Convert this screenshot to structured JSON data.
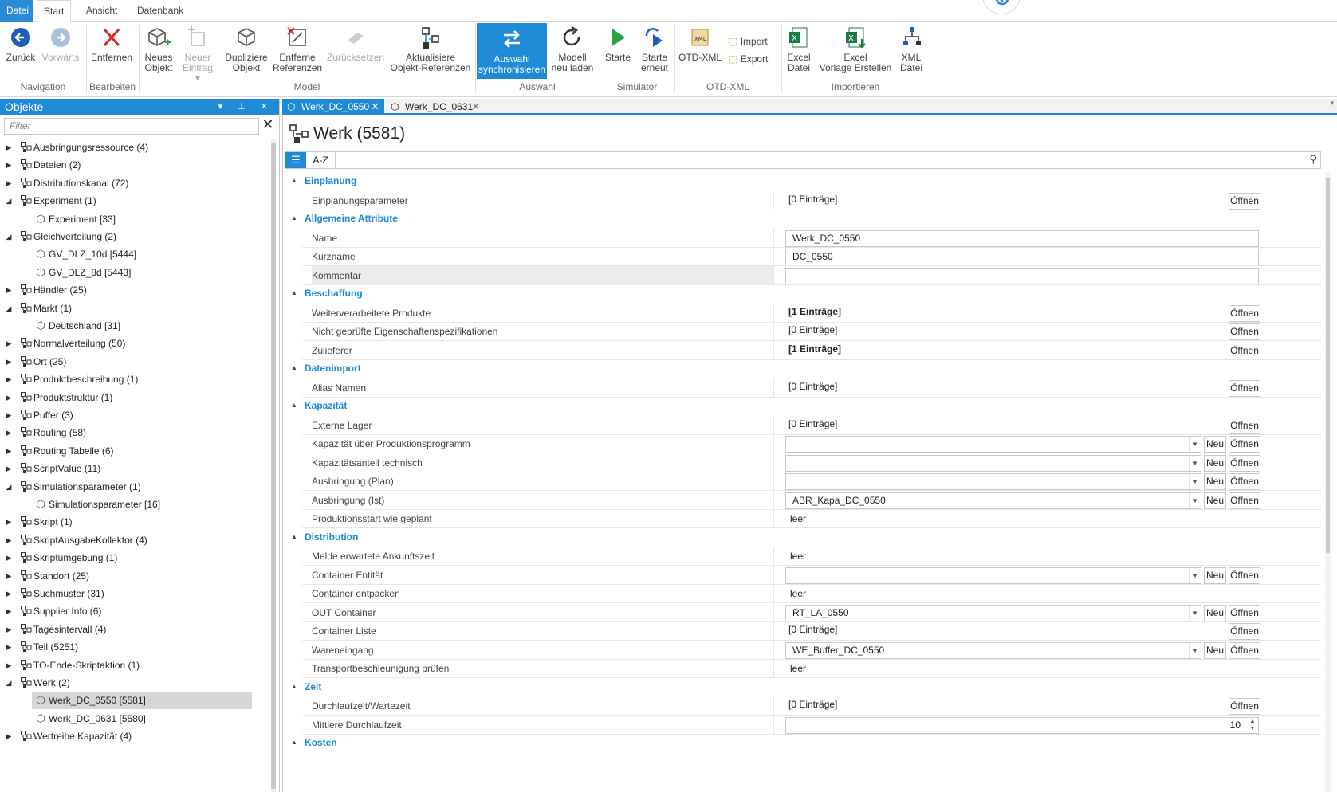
{
  "menu": {
    "file": "Datei",
    "tabs": [
      "Start",
      "Ansicht",
      "Datenbank"
    ]
  },
  "ribbon": {
    "back": "Zurück",
    "forward": "Vorwärts",
    "remove": "Entfernen",
    "new_object_1": "Neues",
    "new_object_2": "Objekt",
    "new_entry_1": "Neuer",
    "new_entry_2": "Eintrag ▾",
    "duplicate_1": "Dupliziere",
    "duplicate_2": "Objekt",
    "remove_refs_1": "Entferne",
    "remove_refs_2": "Referenzen",
    "reset": "Zurücksetzen",
    "update_refs_1": "Aktualisiere",
    "update_refs_2": "Objekt-Referenzen",
    "sync_1": "Auswahl",
    "sync_2": "synchronisieren",
    "reload_1": "Modell",
    "reload_2": "neu laden",
    "start": "Starte",
    "restart_1": "Starte",
    "restart_2": "erneut",
    "otd": "OTD-XML",
    "import": "Import",
    "export": "Export",
    "excel_1": "Excel",
    "excel_2": "Datei",
    "excel_tpl_1": "Excel",
    "excel_tpl_2": "Vorlage Erstellen",
    "xml_1": "XML",
    "xml_2": "Datei",
    "groups": {
      "navigation": "Navigation",
      "edit": "Bearbeiten",
      "model": "Model",
      "selection": "Auswahl",
      "simulator": "Simulator",
      "otd": "OTD-XML",
      "import": "Importieren"
    }
  },
  "objects_panel": {
    "title": "Objekte",
    "filter_placeholder": "Filter",
    "items": [
      {
        "label": "Ausbringungsressource (4)",
        "state": "collapsed",
        "level": 0
      },
      {
        "label": "Dateien (2)",
        "state": "collapsed",
        "level": 0
      },
      {
        "label": "Distributionskanal (72)",
        "state": "collapsed",
        "level": 0
      },
      {
        "label": "Experiment (1)",
        "state": "expanded",
        "level": 0
      },
      {
        "label": "Experiment [33]",
        "state": "leaf",
        "level": 1
      },
      {
        "label": "Gleichverteilung (2)",
        "state": "expanded",
        "level": 0
      },
      {
        "label": "GV_DLZ_10d [5444]",
        "state": "leaf",
        "level": 1
      },
      {
        "label": "GV_DLZ_8d [5443]",
        "state": "leaf",
        "level": 1
      },
      {
        "label": "Händler (25)",
        "state": "collapsed",
        "level": 0
      },
      {
        "label": "Markt (1)",
        "state": "expanded",
        "level": 0
      },
      {
        "label": "Deutschland [31]",
        "state": "leaf",
        "level": 1
      },
      {
        "label": "Normalverteilung (50)",
        "state": "collapsed",
        "level": 0
      },
      {
        "label": "Ort (25)",
        "state": "collapsed",
        "level": 0
      },
      {
        "label": "Produktbeschreibung (1)",
        "state": "collapsed",
        "level": 0
      },
      {
        "label": "Produktstruktur (1)",
        "state": "collapsed",
        "level": 0
      },
      {
        "label": "Puffer (3)",
        "state": "collapsed",
        "level": 0
      },
      {
        "label": "Routing (58)",
        "state": "collapsed",
        "level": 0
      },
      {
        "label": "Routing Tabelle (6)",
        "state": "collapsed",
        "level": 0
      },
      {
        "label": "ScriptValue (11)",
        "state": "collapsed",
        "level": 0
      },
      {
        "label": "Simulationsparameter (1)",
        "state": "expanded",
        "level": 0
      },
      {
        "label": "Simulationsparameter [16]",
        "state": "leaf",
        "level": 1
      },
      {
        "label": "Skript (1)",
        "state": "collapsed",
        "level": 0
      },
      {
        "label": "SkriptAusgabeKollektor (4)",
        "state": "collapsed",
        "level": 0
      },
      {
        "label": "Skriptumgebung (1)",
        "state": "collapsed",
        "level": 0
      },
      {
        "label": "Standort (25)",
        "state": "collapsed",
        "level": 0
      },
      {
        "label": "Suchmuster (31)",
        "state": "collapsed",
        "level": 0
      },
      {
        "label": "Supplier Info (6)",
        "state": "collapsed",
        "level": 0
      },
      {
        "label": "Tagesintervall (4)",
        "state": "collapsed",
        "level": 0
      },
      {
        "label": "Teil (5251)",
        "state": "collapsed",
        "level": 0
      },
      {
        "label": "TO-Ende-Skriptaktion (1)",
        "state": "collapsed",
        "level": 0
      },
      {
        "label": "Werk (2)",
        "state": "expanded",
        "level": 0
      },
      {
        "label": "Werk_DC_0550 [5581]",
        "state": "leaf",
        "level": 1,
        "selected": true
      },
      {
        "label": "Werk_DC_0631 [5580]",
        "state": "leaf",
        "level": 1
      },
      {
        "label": "Wertreihe Kapazität (4)",
        "state": "collapsed",
        "level": 0
      }
    ]
  },
  "doc_tabs": [
    {
      "label": "Werk_DC_0550",
      "active": true
    },
    {
      "label": "Werk_DC_0631",
      "active": false
    }
  ],
  "page": {
    "title": "Werk (5581)",
    "view_az": "A-Z"
  },
  "buttons": {
    "open": "Öffnen",
    "new": "Neu"
  },
  "sections": [
    {
      "title": "Einplanung",
      "rows": [
        {
          "label": "Einplanungsparameter",
          "type": "list",
          "value": "[0 Einträge]"
        }
      ]
    },
    {
      "title": "Allgemeine Attribute",
      "rows": [
        {
          "label": "Name",
          "type": "text",
          "value": "Werk_DC_0550"
        },
        {
          "label": "Kurzname",
          "type": "text",
          "value": "DC_0550"
        },
        {
          "label": "Kommentar",
          "type": "text",
          "value": "",
          "highlight": true
        }
      ]
    },
    {
      "title": "Beschaffung",
      "rows": [
        {
          "label": "Weiterverarbeitete Produkte",
          "type": "list",
          "value": "[1 Einträge]",
          "bold": true
        },
        {
          "label": "Nicht geprüfte Eigenschaftenspezifikationen",
          "type": "list",
          "value": "[0 Einträge]"
        },
        {
          "label": "Zulieferer",
          "type": "list",
          "value": "[1 Einträge]",
          "bold": true
        }
      ]
    },
    {
      "title": "Datenimport",
      "rows": [
        {
          "label": "Alias Namen",
          "type": "list",
          "value": "[0 Einträge]"
        }
      ]
    },
    {
      "title": "Kapazität",
      "rows": [
        {
          "label": "Externe Lager",
          "type": "list",
          "value": "[0 Einträge]"
        },
        {
          "label": "Kapazität über Produktionsprogramm",
          "type": "ref",
          "value": ""
        },
        {
          "label": "Kapazitätsanteil technisch",
          "type": "ref",
          "value": ""
        },
        {
          "label": "Ausbringung (Plan)",
          "type": "ref",
          "value": ""
        },
        {
          "label": "Ausbringung (Ist)",
          "type": "ref",
          "value": "ABR_Kapa_DC_0550"
        },
        {
          "label": "Produktionsstart wie geplant",
          "type": "plain",
          "value": "leer"
        }
      ]
    },
    {
      "title": "Distribution",
      "rows": [
        {
          "label": "Melde erwartete Ankunftszeit",
          "type": "plain",
          "value": "leer"
        },
        {
          "label": "Container Entität",
          "type": "ref",
          "value": ""
        },
        {
          "label": "Container entpacken",
          "type": "plain",
          "value": "leer"
        },
        {
          "label": "OUT Container",
          "type": "ref",
          "value": "RT_LA_0550"
        },
        {
          "label": "Container Liste",
          "type": "list",
          "value": "[0 Einträge]"
        },
        {
          "label": "Wareneingang",
          "type": "ref",
          "value": "WE_Buffer_DC_0550"
        },
        {
          "label": "Transportbeschleunigung prüfen",
          "type": "plain",
          "value": "leer"
        }
      ]
    },
    {
      "title": "Zeit",
      "rows": [
        {
          "label": "Durchlaufzeit/Wartezeit",
          "type": "list",
          "value": "[0 Einträge]"
        },
        {
          "label": "Mittlere Durchlaufzeit",
          "type": "number",
          "value": "10"
        }
      ]
    },
    {
      "title": "Kosten",
      "rows": []
    }
  ],
  "colors": {
    "accent": "#1f8ad6",
    "ribbon_selected": "#1f8ad6",
    "start_green": "#2aa44a",
    "remove_red": "#d42a2a"
  }
}
